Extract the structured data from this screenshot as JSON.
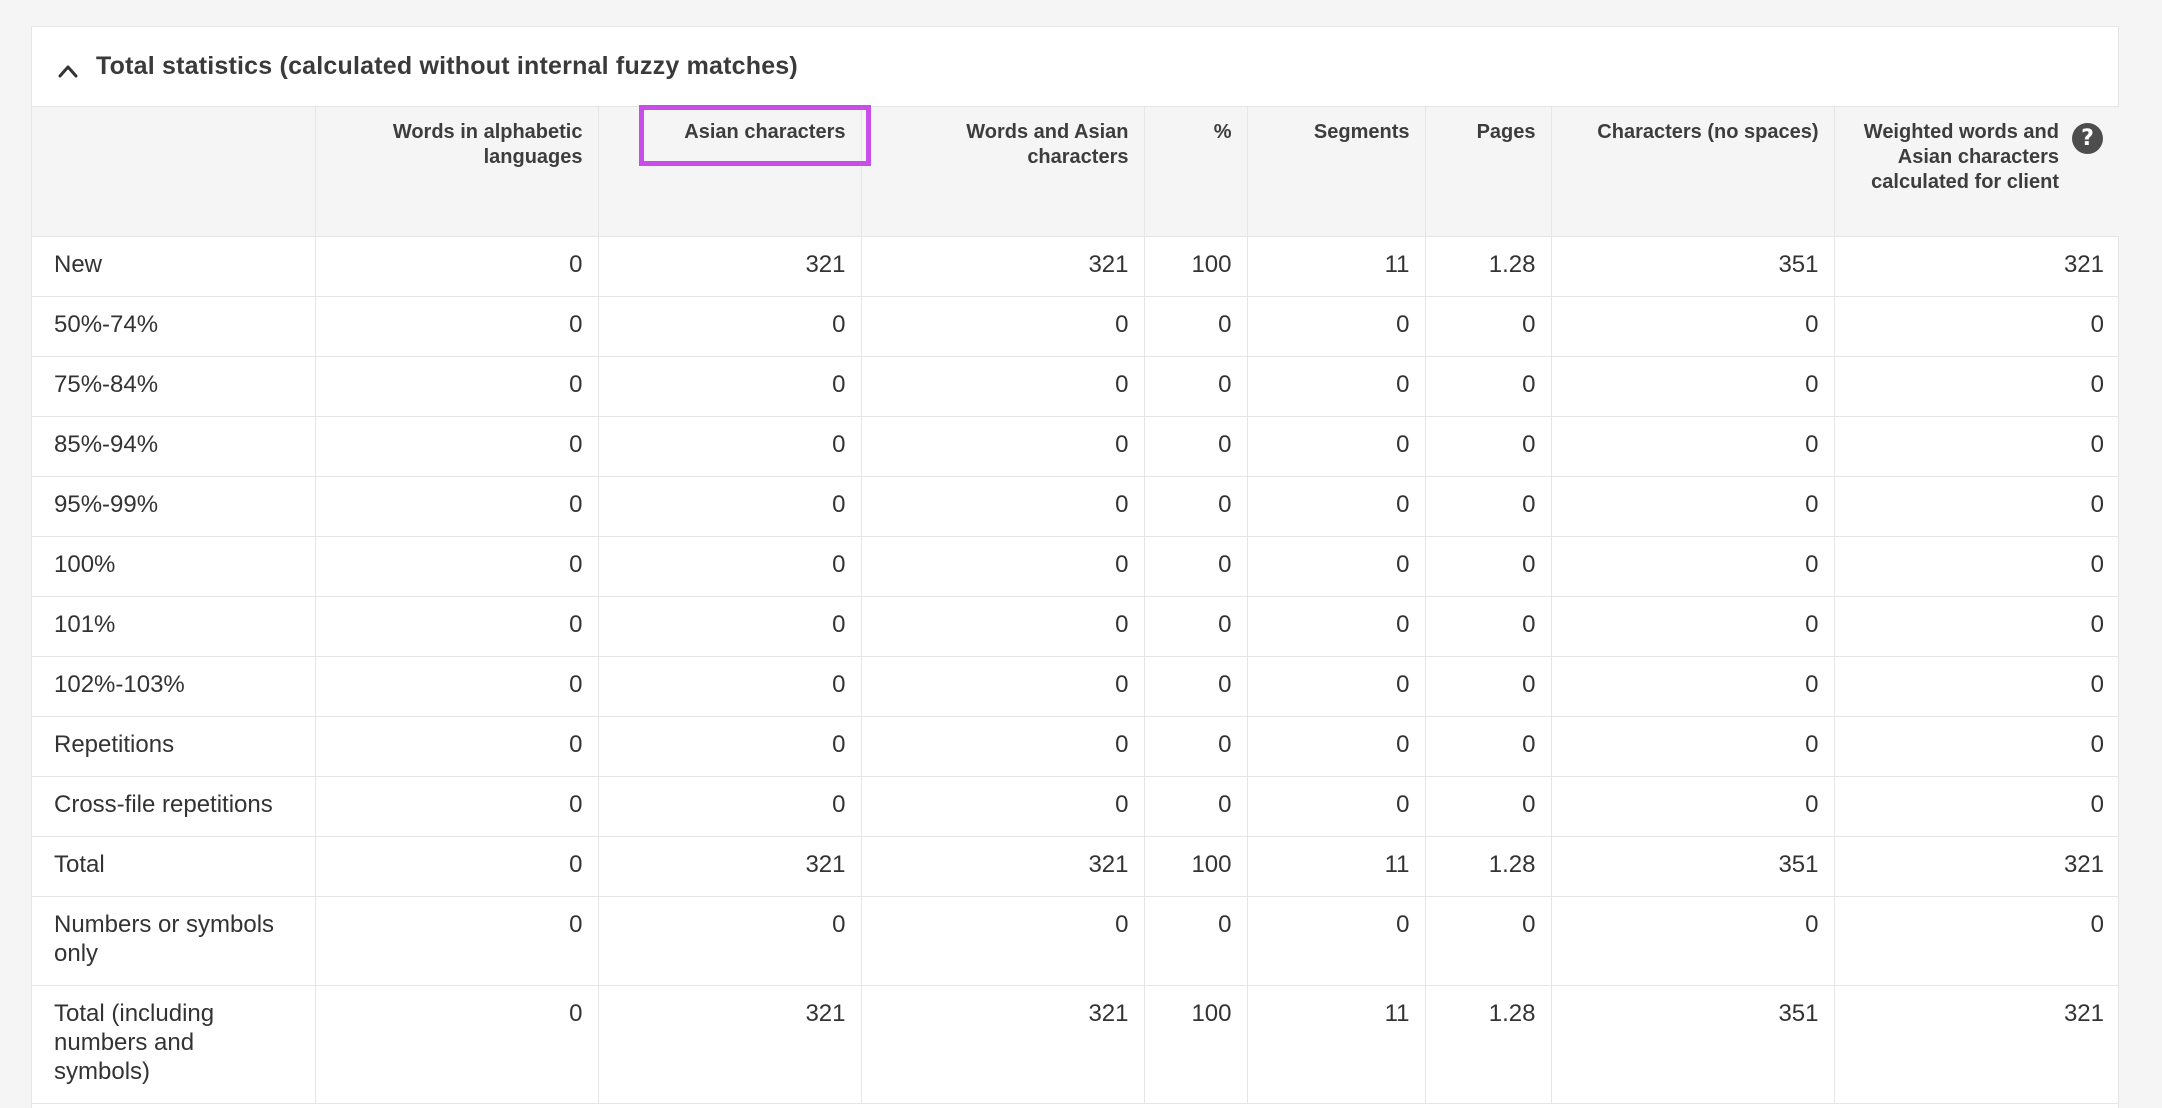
{
  "panel": {
    "title": "Total statistics (calculated without internal fuzzy matches)",
    "toggle_icon": "chevron-up-icon"
  },
  "table": {
    "columns": [
      "",
      "Words in alphabetic languages",
      "Asian characters",
      "Words and Asian characters",
      "%",
      "Segments",
      "Pages",
      "Characters (no spaces)",
      "Weighted words and Asian characters calculated for client"
    ],
    "highlight_color": "#c94ee8",
    "help_icon": "question-mark-icon",
    "help_glyph": "?",
    "rows": [
      {
        "label": "New",
        "values": [
          "0",
          "321",
          "321",
          "100",
          "11",
          "1.28",
          "351",
          "321"
        ]
      },
      {
        "label": "50%-74%",
        "values": [
          "0",
          "0",
          "0",
          "0",
          "0",
          "0",
          "0",
          "0"
        ]
      },
      {
        "label": "75%-84%",
        "values": [
          "0",
          "0",
          "0",
          "0",
          "0",
          "0",
          "0",
          "0"
        ]
      },
      {
        "label": "85%-94%",
        "values": [
          "0",
          "0",
          "0",
          "0",
          "0",
          "0",
          "0",
          "0"
        ]
      },
      {
        "label": "95%-99%",
        "values": [
          "0",
          "0",
          "0",
          "0",
          "0",
          "0",
          "0",
          "0"
        ]
      },
      {
        "label": "100%",
        "values": [
          "0",
          "0",
          "0",
          "0",
          "0",
          "0",
          "0",
          "0"
        ]
      },
      {
        "label": "101%",
        "values": [
          "0",
          "0",
          "0",
          "0",
          "0",
          "0",
          "0",
          "0"
        ]
      },
      {
        "label": "102%-103%",
        "values": [
          "0",
          "0",
          "0",
          "0",
          "0",
          "0",
          "0",
          "0"
        ]
      },
      {
        "label": "Repetitions",
        "values": [
          "0",
          "0",
          "0",
          "0",
          "0",
          "0",
          "0",
          "0"
        ]
      },
      {
        "label": "Cross-file repetitions",
        "values": [
          "0",
          "0",
          "0",
          "0",
          "0",
          "0",
          "0",
          "0"
        ]
      },
      {
        "label": "Total",
        "values": [
          "0",
          "321",
          "321",
          "100",
          "11",
          "1.28",
          "351",
          "321"
        ]
      },
      {
        "label": "Numbers or symbols only",
        "values": [
          "0",
          "0",
          "0",
          "0",
          "0",
          "0",
          "0",
          "0"
        ]
      },
      {
        "label": "Total (including numbers and symbols)",
        "values": [
          "0",
          "321",
          "321",
          "100",
          "11",
          "1.28",
          "351",
          "321"
        ]
      }
    ]
  }
}
